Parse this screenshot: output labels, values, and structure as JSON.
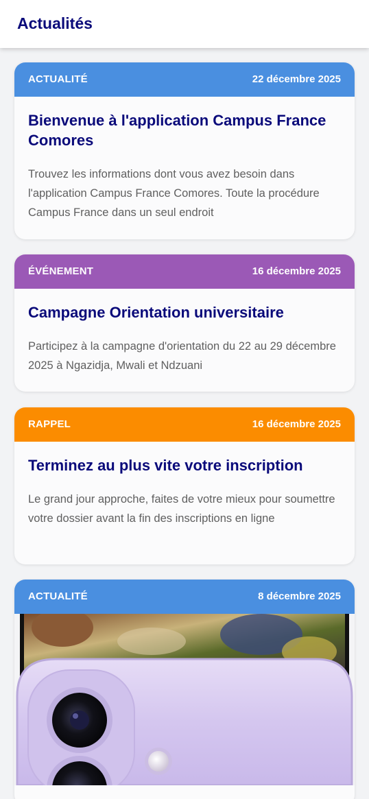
{
  "app_bar": {
    "title": "Actualités"
  },
  "colors": {
    "actualite": "#4a8fe0",
    "evenement": "#9b59b6",
    "rappel": "#fb8c00",
    "title": "#0a0a7a"
  },
  "cards": [
    {
      "category": "ACTUALITÉ",
      "date": "22 décembre 2025",
      "title": "Bienvenue à l'application Campus France Comores",
      "description": "Trouvez les informations dont vous avez besoin dans l'application Campus France Comores. Toute la procédure Campus France dans un seul endroit"
    },
    {
      "category": "ÉVÉNEMENT",
      "date": "16 décembre 2025",
      "title": "Campagne Orientation universitaire",
      "description": "Participez à la campagne d'orientation du 22 au 29 décembre 2025 à Ngazidja, Mwali et Ndzuani"
    },
    {
      "category": "RAPPEL",
      "date": "16 décembre 2025",
      "title": "Terminez au plus vite votre inscription",
      "description": "Le grand jour approche, faites de votre mieux pour soumettre votre dossier avant la fin des inscriptions en ligne"
    },
    {
      "category": "ACTUALITÉ",
      "date": "8 décembre 2025",
      "image": "purple-smartphone-photo"
    }
  ]
}
